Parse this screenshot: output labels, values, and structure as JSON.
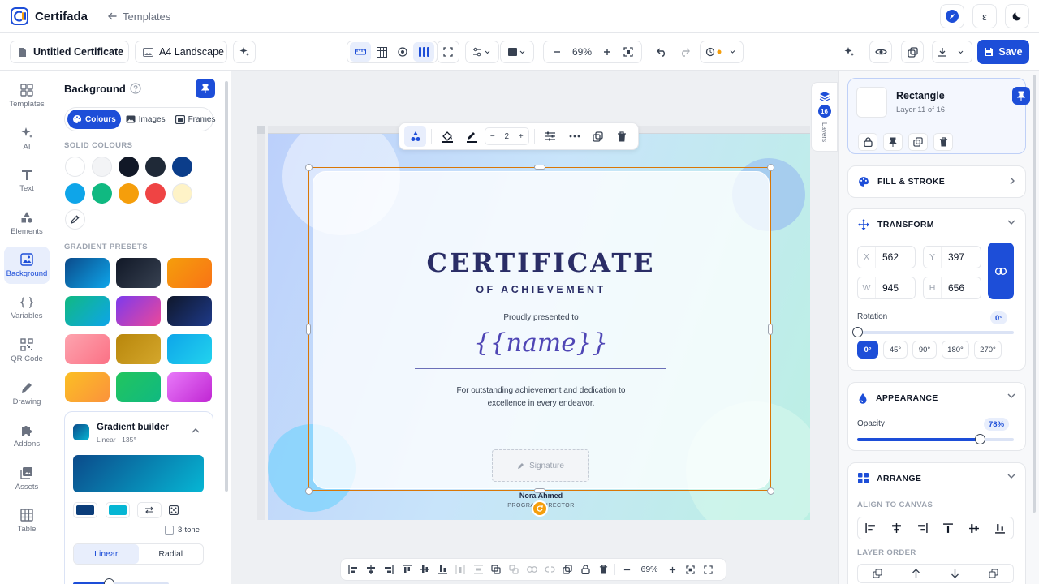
{
  "app": {
    "name": "Certifada",
    "back_label": "Templates"
  },
  "top_right": {
    "locale_label": "ε"
  },
  "toolbar": {
    "doc_name": "Untitled Certificate",
    "page_size": "A4 Landscape",
    "zoom": "69%",
    "save_label": "Save"
  },
  "rail": [
    "Templates",
    "AI",
    "Text",
    "Elements",
    "Background",
    "Variables",
    "QR Code",
    "Drawing",
    "Addons",
    "Assets",
    "Table"
  ],
  "left_panel": {
    "title": "Background",
    "tabs": [
      "Colours",
      "Images",
      "Frames"
    ],
    "solid_heading": "SOLID COLOURS",
    "solid_colours": [
      "#ffffff",
      "#f3f4f6",
      "#111827",
      "#1f2937",
      "#0b3d8a",
      "#0ea5e9",
      "#10b981",
      "#f59e0b",
      "#ef4444",
      "#fef3c7"
    ],
    "gradient_heading": "GRADIENT PRESETS",
    "gradient_presets": [
      [
        "#0b4a8a",
        "#0ea5e9"
      ],
      [
        "#111827",
        "#374151"
      ],
      [
        "#f59e0b",
        "#f97316"
      ],
      [
        "#10b981",
        "#0ea5e9"
      ],
      [
        "#7c3aed",
        "#ec4899"
      ],
      [
        "#0f172a",
        "#1e3a8a"
      ],
      [
        "#fda4af",
        "#fb7185"
      ],
      [
        "#b8860b",
        "#d4a72c"
      ],
      [
        "#0ea5e9",
        "#22d3ee"
      ],
      [
        "#fbbf24",
        "#fb923c"
      ],
      [
        "#22c55e",
        "#10b981"
      ],
      [
        "#e879f9",
        "#c026d3"
      ]
    ],
    "builder": {
      "title": "Gradient builder",
      "subtitle": "Linear · 135°",
      "three_tone": "3-tone",
      "modes": [
        "Linear",
        "Radial"
      ],
      "stop_a": "#0b3d7a",
      "stop_b": "#06b6d4"
    }
  },
  "certificate": {
    "title": "CERTIFICATE",
    "subtitle": "OF ACHIEVEMENT",
    "presented": "Proudly presented to",
    "name": "{{name}}",
    "desc_line1": "For outstanding achievement and dedication to",
    "desc_line2": "excellence in every endeavor.",
    "signature_placeholder": "Signature",
    "signer": "Nora Ahmed",
    "signer_role": "PROGRAM DIRECTOR"
  },
  "float_toolbar": {
    "stroke_width": "2"
  },
  "layers": {
    "count": "16",
    "label": "Layers"
  },
  "bottom_bar": {
    "zoom": "69%"
  },
  "right_panel": {
    "selected": {
      "name": "Rectangle",
      "layer": "Layer 11 of 16"
    },
    "fill_stroke": "FILL & STROKE",
    "transform": {
      "title": "TRANSFORM",
      "x": "562",
      "y": "397",
      "w": "945",
      "h": "656",
      "rotation_label": "Rotation",
      "rotation_value": "0°",
      "rotation_fraction": 0,
      "presets": [
        "0°",
        "45°",
        "90°",
        "180°",
        "270°"
      ]
    },
    "appearance": {
      "title": "APPEARANCE",
      "opacity_label": "Opacity",
      "opacity_value": "78%",
      "opacity_fraction": 0.78
    },
    "arrange": {
      "title": "ARRANGE",
      "align_label": "ALIGN TO CANVAS",
      "order_label": "LAYER ORDER"
    }
  },
  "colors": {
    "accent": "#1d4ed8",
    "selection": "#d97706"
  }
}
